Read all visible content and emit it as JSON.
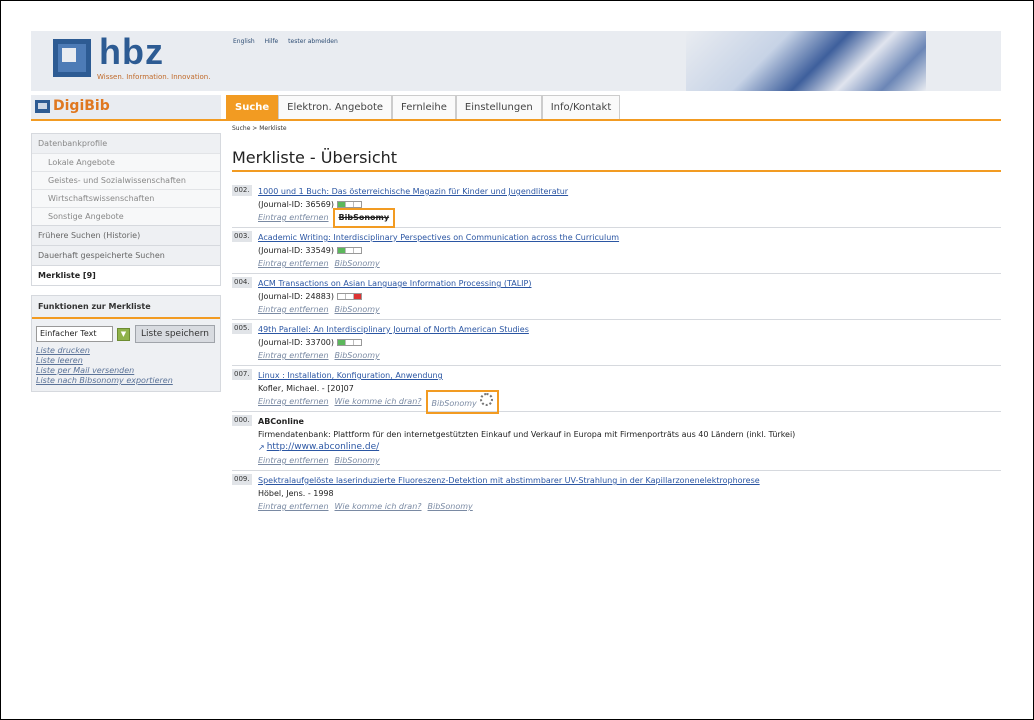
{
  "header": {
    "logo_text": "hbz",
    "logo_tagline": "Wissen. Information. Innovation.",
    "top_links": [
      "English",
      "Hilfe",
      "tester abmelden"
    ]
  },
  "brand": "DigiBib",
  "tabs": [
    {
      "label": "Suche",
      "active": true
    },
    {
      "label": "Elektron. Angebote",
      "active": false
    },
    {
      "label": "Fernleihe",
      "active": false
    },
    {
      "label": "Einstellungen",
      "active": false
    },
    {
      "label": "Info/Kontakt",
      "active": false
    }
  ],
  "breadcrumb": "Suche > Merkliste",
  "sidebar": {
    "heading": "Datenbankprofile",
    "profiles": [
      "Lokale Angebote",
      "Geistes- und Sozialwissenschaften",
      "Wirtschaftswissenschaften",
      "Sonstige Angebote"
    ],
    "history": "Frühere Suchen (Historie)",
    "saved": "Dauerhaft gespeicherte Suchen",
    "merkliste": "Merkliste [9]",
    "functions": {
      "title": "Funktionen zur Merkliste",
      "format_value": "Einfacher Text",
      "save_button": "Liste speichern",
      "links": [
        "Liste drucken",
        "Liste leeren",
        "Liste per Mail versenden",
        "Liste nach Bibsonomy exportieren"
      ]
    }
  },
  "main": {
    "title": "Merkliste - Übersicht",
    "items": [
      {
        "num": "002.",
        "title": "1000 und 1 Buch: Das österreichische Magazin für Kinder und Jugendliteratur",
        "meta": "(Journal-ID: 36569)",
        "actions": [
          "Eintrag entfernen",
          "BibSonomy"
        ]
      },
      {
        "num": "003.",
        "title": "Academic Writing: Interdisciplinary Perspectives on Communication across the Curriculum",
        "meta": "(Journal-ID: 33549)",
        "actions": [
          "Eintrag entfernen",
          "BibSonomy"
        ]
      },
      {
        "num": "004.",
        "title": "ACM Transactions on Asian Language Information Processing (TALIP)",
        "meta": "(Journal-ID: 24883)",
        "actions": [
          "Eintrag entfernen",
          "BibSonomy"
        ]
      },
      {
        "num": "005.",
        "title": "49th Parallel: An Interdisciplinary Journal of North American Studies",
        "meta": "(Journal-ID: 33700)",
        "actions": [
          "Eintrag entfernen",
          "BibSonomy"
        ]
      },
      {
        "num": "007.",
        "title": "Linux : Installation, Konfiguration, Anwendung",
        "meta": "Kofler, Michael. - [20]07",
        "actions": [
          "Eintrag entfernen",
          "Wie komme ich dran?",
          "BibSonomy"
        ]
      },
      {
        "num": "000.",
        "title": "ABConline",
        "meta": "Firmendatenbank: Plattform für den internetgestützten Einkauf und Verkauf in Europa mit Firmenporträts aus 40 Ländern (inkl. Türkei)",
        "url": "http://www.abconline.de/",
        "actions": [
          "Eintrag entfernen",
          "BibSonomy"
        ]
      },
      {
        "num": "009.",
        "title": "Spektralaufgelöste laserinduzierte Fluoreszenz-Detektion mit abstimmbarer UV-Strahlung in der Kapillarzonenelektrophorese",
        "meta": "Höbel, Jens. - 1998",
        "actions": [
          "Eintrag entfernen",
          "Wie komme ich dran?",
          "BibSonomy"
        ]
      }
    ]
  }
}
